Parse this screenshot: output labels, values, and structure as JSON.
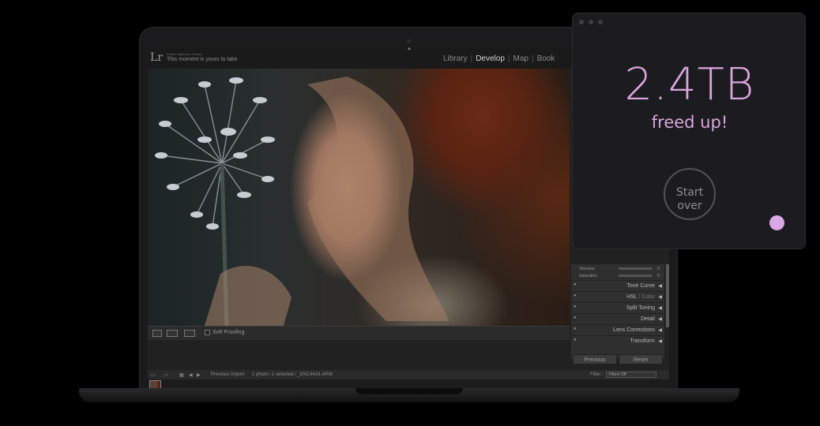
{
  "lightroom": {
    "logo": "Lr",
    "app_name": "Adobe Lightroom Classic",
    "tagline": "This moment is yours to take",
    "modules": [
      "Library",
      "Develop",
      "Map",
      "Book"
    ],
    "active_module": "Develop",
    "toolbar": {
      "soft_proofing": "Soft Proofing"
    },
    "panel": {
      "sliders": [
        {
          "name": "Vibrance",
          "value": "0"
        },
        {
          "name": "Saturation",
          "value": "0"
        }
      ],
      "sections": [
        {
          "label": "Tone Curve"
        },
        {
          "label": "HSL",
          "sep": " / ",
          "label_b": "Color"
        },
        {
          "label": "Split Toning"
        },
        {
          "label": "Detail"
        },
        {
          "label": "Lens Corrections"
        },
        {
          "label": "Transform"
        }
      ],
      "previous": "Previous",
      "reset": "Reset"
    },
    "filmstrip": {
      "source": "Previous Import",
      "count": "1 photo / 1 selected /",
      "filename": "_DSC4418.ARW",
      "filter_label": "Filter :",
      "filter_value": "Filters Off"
    }
  },
  "overlay": {
    "amount": "2.4TB",
    "label": "freed up!",
    "start_over": "Start over",
    "colors": {
      "accent": "#d9a6dd",
      "dot": "#dca7e6",
      "background": "#1c1b1f"
    }
  }
}
